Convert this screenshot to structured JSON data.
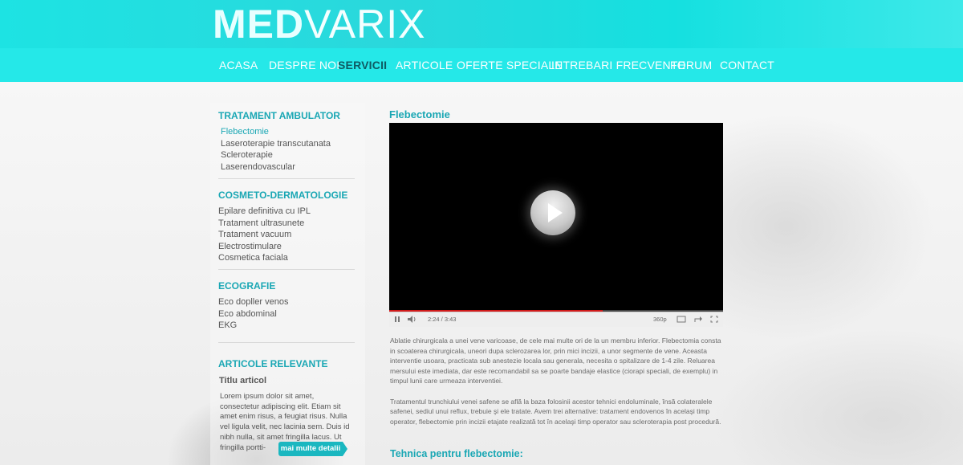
{
  "logo": {
    "part1": "MED",
    "part2": "VARIX"
  },
  "nav": {
    "items": [
      "ACASA",
      "DESPRE NOI",
      "SERVICII",
      "ARTICOLE",
      "OFERTE SPECIALE",
      "INTREBARI FRECVENTE",
      "FORUM",
      "CONTACT"
    ],
    "active": "SERVICII"
  },
  "sidebar": {
    "sections": [
      {
        "title": "TRATAMENT AMBULATOR",
        "items": [
          "Flebectomie",
          "Laseroterapie transcutanata",
          "Scleroterapie",
          "Laserendovascular"
        ],
        "active": "Flebectomie"
      },
      {
        "title": "COSMETO-DERMATOLOGIE",
        "items": [
          "Epilare definitiva cu IPL",
          "Tratament ultrasunete",
          "Tratament vacuum",
          "Electrostimulare",
          "Cosmetica faciala"
        ]
      },
      {
        "title": "ECOGRAFIE",
        "items": [
          "Eco dopller venos",
          "Eco abdominal",
          "EKG"
        ]
      }
    ],
    "articles": {
      "title": "ARTICOLE RELEVANTE",
      "article_title": "Titlu articol",
      "excerpt": "Lorem ipsum dolor sit amet, consectetur adipiscing elit. Etiam sit amet enim risus, a feugiat risus. Nulla vel ligula velit, nec lacinia sem. Duis id nibh nulla, sit amet fringilla lacus. Ut fringilla portti-",
      "more_label": "mai multe detalii"
    }
  },
  "main": {
    "title": "Flebectomie",
    "video": {
      "time": "2:24 / 3:43",
      "quality": "360p",
      "progress": 0.64
    },
    "paragraphs": [
      "Ablatie chirurgicala a unei vene varicoase, de cele mai multe ori de la un membru inferior. Flebectomia consta in scoaterea chirurgicala, uneori dupa sclerozarea lor, prin mici incizii, a unor segmente de vene. Aceasta interventie usoara, practicata sub anestezie locala sau generala, necesita o spitalizare de 1-4 zile. Reluarea mersului este imediata, dar este recomandabil sa se poarte bandaje elastice (ciorapi speciali, de exemplu) in timpul lunii care urmeaza interventiei.",
      "Tratamentul trunchiului venei safene se află la baza folosinii acestor tehnici endoluminale, însă colateralele safenei, sediul unui reflux, trebuie şi ele tratate. Avem trei alternative: tratament endovenos în acelaşi timp operator, flebectomie prin incizii etajate realizată tot în acelaşi timp operator sau scleroterapia post procedură."
    ],
    "subtitle": "Tehnica pentru flebectomie:"
  },
  "colors": {
    "accent": "#1aa7b4",
    "nav_bg": "#25e8e8",
    "active_nav": "#0e5b63"
  }
}
